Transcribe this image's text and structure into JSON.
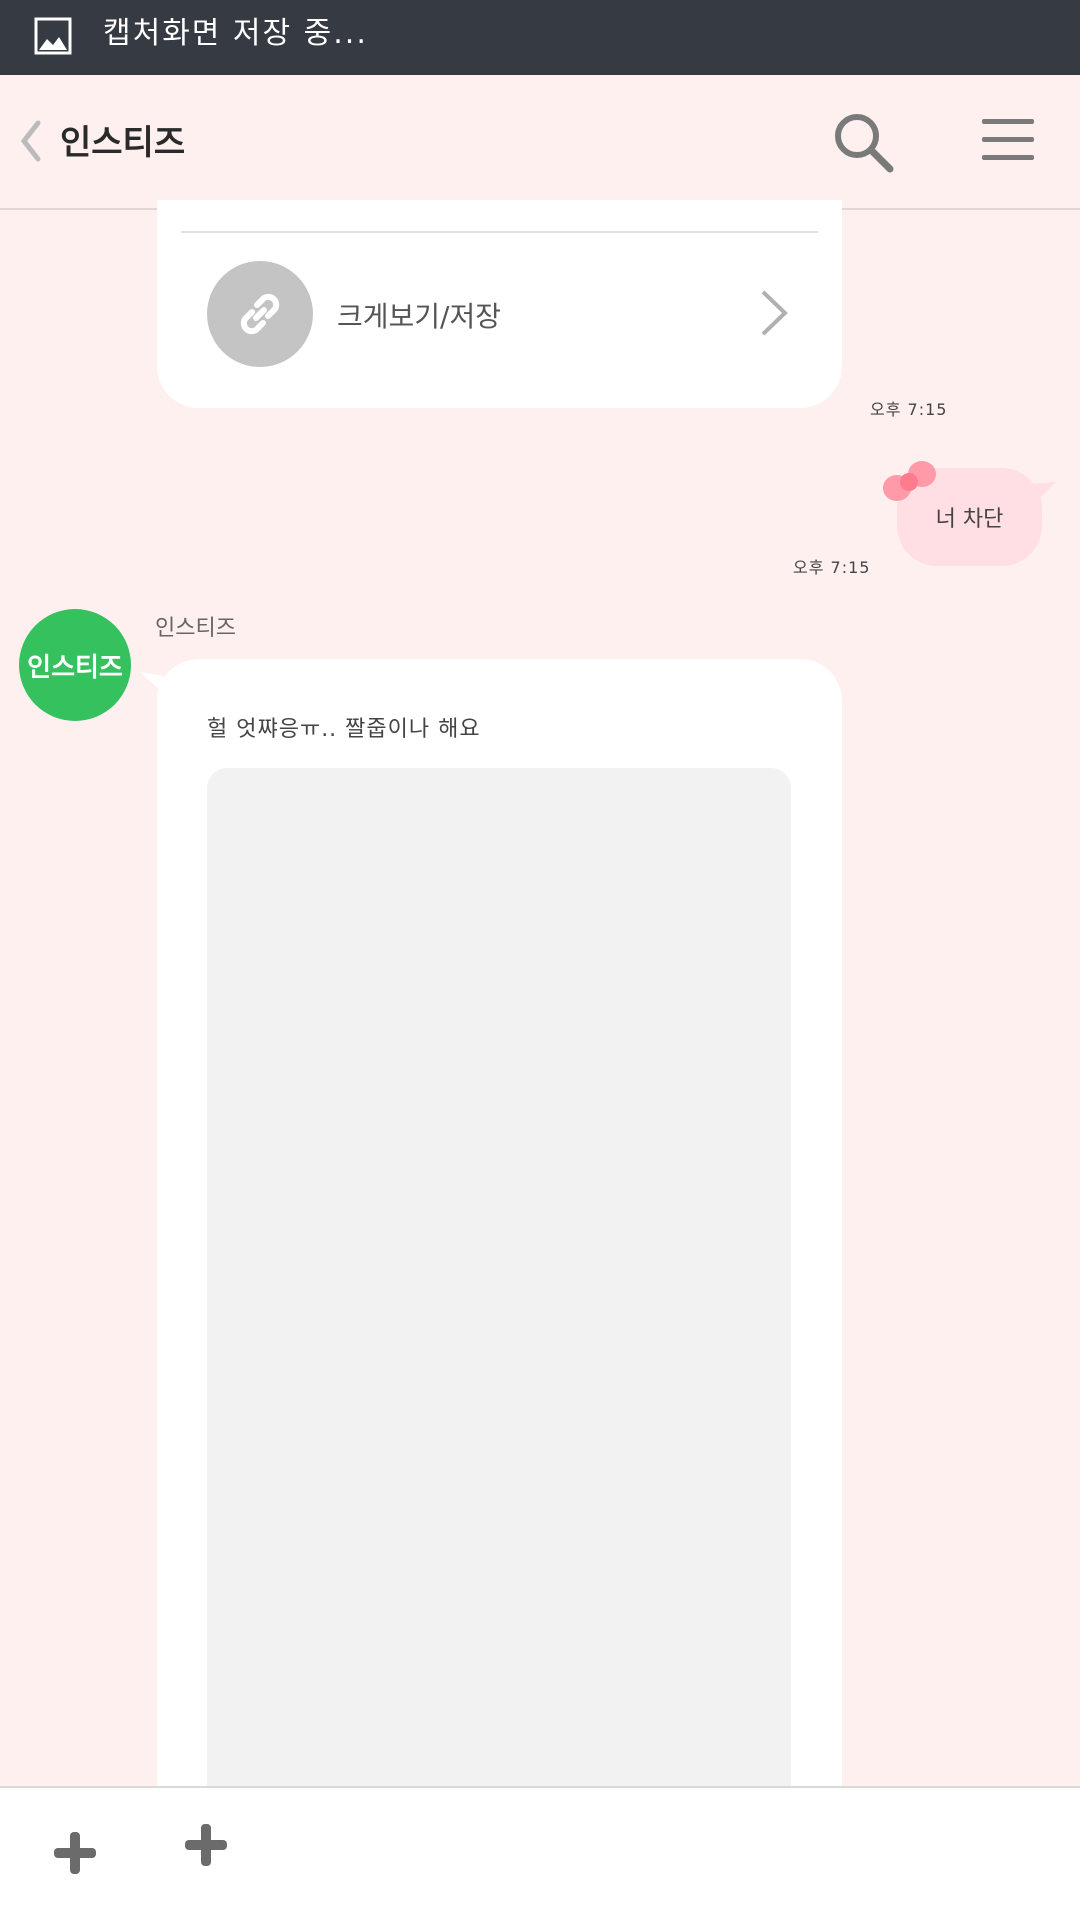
{
  "status_bar": {
    "text": "캡처화면 저장 중...",
    "icon": "image-icon"
  },
  "header": {
    "title": "인스티즈",
    "back_icon": "chevron-left-icon",
    "search_icon": "search-icon",
    "menu_icon": "hamburger-menu-icon"
  },
  "messages": {
    "link_card": {
      "label": "크게보기/저장",
      "icon": "link-icon"
    },
    "time_1": "오후 7:15",
    "my_message": "너 차단",
    "time_2": "오후 7:15",
    "incoming": {
      "sender": "인스티즈",
      "avatar_text": "인스티즈",
      "avatar_color": "#36c15f",
      "text": "헐 엇쨔응ㅠ.. 짤줍이나 해요"
    }
  },
  "bottom_bar": {
    "plus_icon": "plus-icon"
  },
  "colors": {
    "background": "#fff0f0",
    "status_bar": "#363a42",
    "my_bubble": "#ffdfe3"
  }
}
